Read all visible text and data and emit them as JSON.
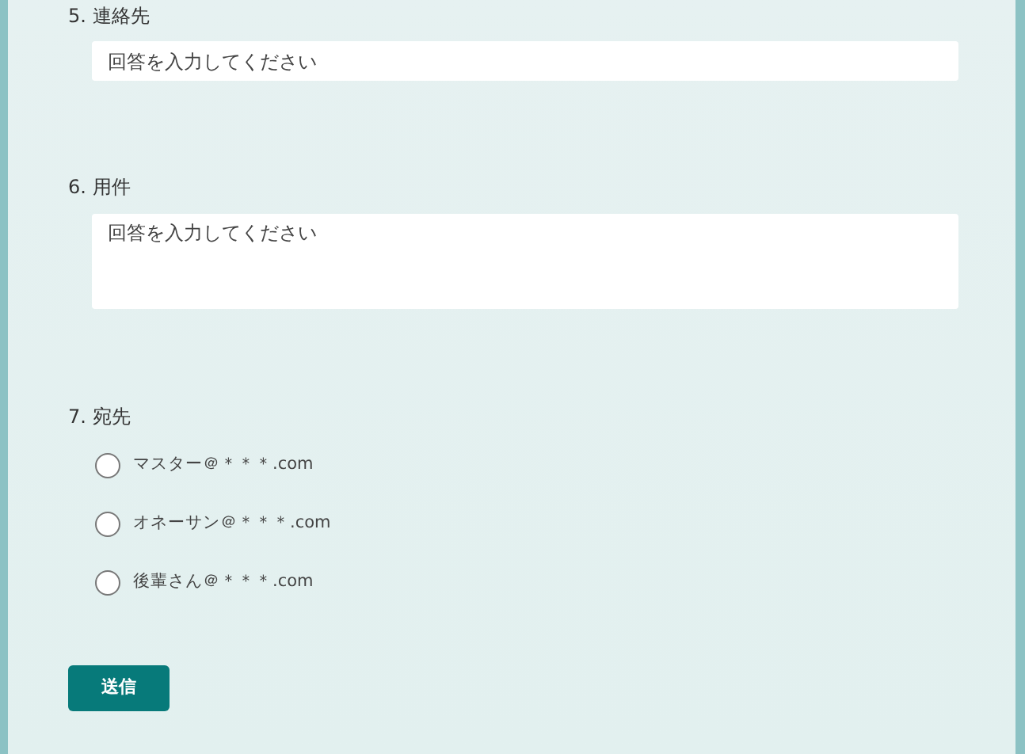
{
  "questions": [
    {
      "kind": "text",
      "label": "5. 連絡先",
      "placeholder": "回答を入力してください"
    },
    {
      "kind": "textarea",
      "label": "6. 用件",
      "placeholder": "回答を入力してください"
    },
    {
      "kind": "choice",
      "label": "7. 宛先",
      "options": [
        {
          "label": "マスター＠＊＊＊.com",
          "selected": false
        },
        {
          "label": "オネーサン＠＊＊＊.com",
          "selected": false
        },
        {
          "label": "後輩さん＠＊＊＊.com",
          "selected": false
        }
      ]
    }
  ],
  "submit": "送信"
}
